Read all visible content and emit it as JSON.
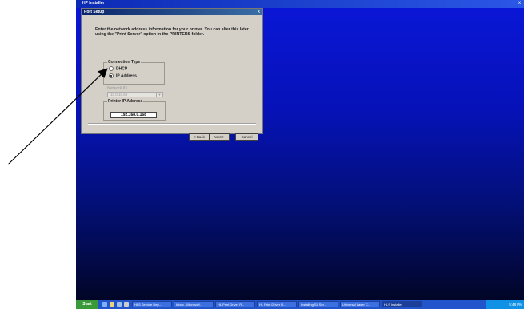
{
  "installer": {
    "title": "HP Installer",
    "close": "x"
  },
  "dialog": {
    "title": "Port Setup",
    "close": "x",
    "instructions": "Enter the network address information for your printer. You can alter this later using the \"Print Server\" option in the PRINTERS folder.",
    "connection_type": {
      "label": "Connection Type",
      "options": [
        {
          "label": "DHCP",
          "selected": false
        },
        {
          "label": "IP Address",
          "selected": true
        }
      ]
    },
    "network_id": {
      "label": "Network ID",
      "value": "10.0.10.69"
    },
    "printer_ip": {
      "label": "Printer IP Address",
      "value": "192.168.0.168"
    },
    "buttons": {
      "back": "< Back",
      "next": "Next >",
      "cancel": "Cancel"
    }
  },
  "taskbar": {
    "start": "Start",
    "items": [
      {
        "label": "HLS Service Dep...",
        "active": false
      },
      {
        "label": "Inbox - Microsoft...",
        "active": false
      },
      {
        "label": "HL Print Driver R...",
        "active": false
      },
      {
        "label": "HL Print Driver R...",
        "active": false
      },
      {
        "label": "Installing SL Ser...",
        "active": false
      },
      {
        "label": "Universal Laser C...",
        "active": false
      },
      {
        "label": "HLS Installer",
        "active": true
      }
    ],
    "clock": "5:48 PM"
  }
}
